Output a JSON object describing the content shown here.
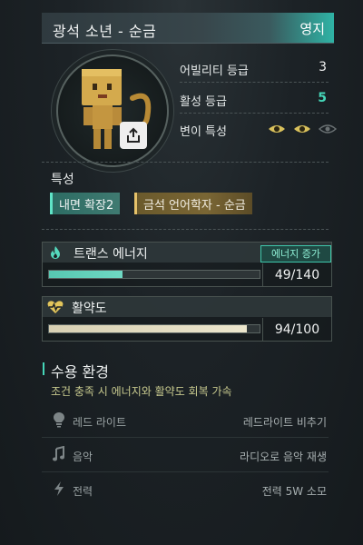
{
  "header": {
    "title": "광석 소년 - 순금",
    "badge": "영지"
  },
  "portrait": {
    "share_icon": "share-icon",
    "figure_color": "#c9a04a"
  },
  "stats": [
    {
      "label": "어빌리티 등급",
      "value": "3"
    },
    {
      "label": "활성 등급",
      "value": "5"
    },
    {
      "label": "변이 특성",
      "value": ""
    }
  ],
  "mutation_eyes": {
    "active": 2,
    "total": 3
  },
  "traits": {
    "label": "특성",
    "chips": [
      "내면 확장2",
      "금석 언어학자 - 순금"
    ]
  },
  "energy": {
    "label": "트랜스 에너지",
    "boost_label": "에너지 증가",
    "value_text": "49/140",
    "fill": 0.35
  },
  "vitality": {
    "label": "활약도",
    "value_text": "94/100",
    "fill": 0.94
  },
  "environment": {
    "title": "수용 환경",
    "subtitle": "조건 충족 시 에너지와 활약도 회복 가속",
    "rows": [
      {
        "icon": "lightbulb-icon",
        "label": "레드 라이트",
        "value": "레드라이트 비추기"
      },
      {
        "icon": "music-note-icon",
        "label": "음악",
        "value": "라디오로 음악 재생"
      },
      {
        "icon": "lightning-icon",
        "label": "전력",
        "value": "전력 5W 소모"
      }
    ]
  },
  "colors": {
    "accent": "#45d6b8",
    "gold": "#e6c26a"
  }
}
